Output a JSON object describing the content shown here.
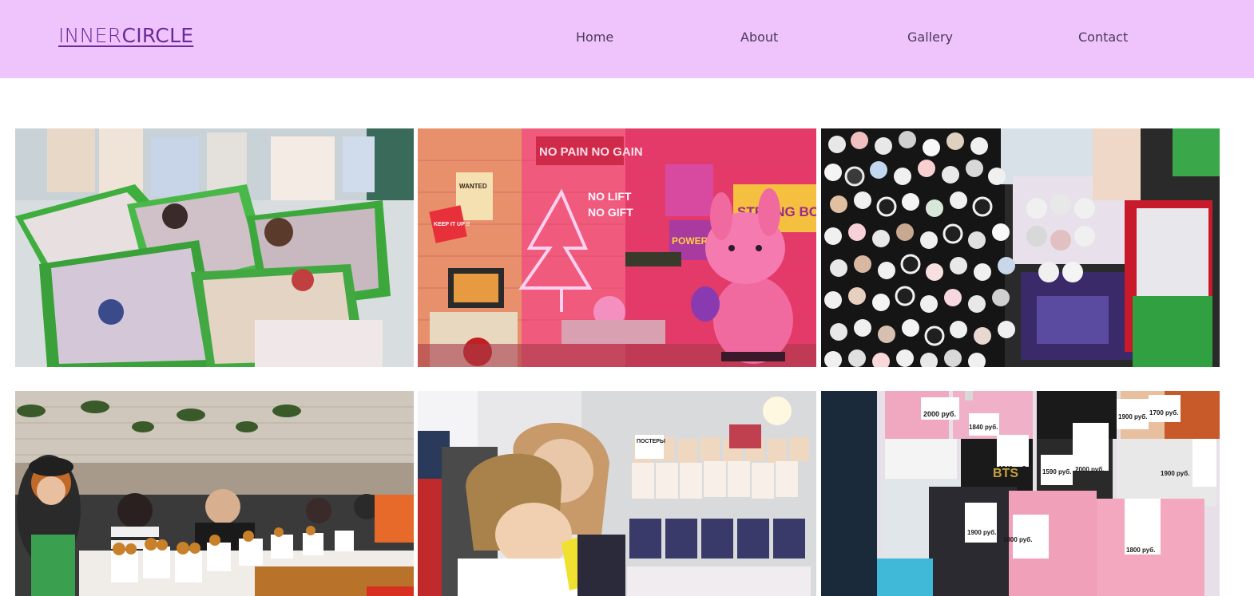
{
  "brand": {
    "part1": "INNER",
    "part2": "CIRCLE"
  },
  "nav": {
    "home": "Home",
    "about": "About",
    "gallery": "Gallery",
    "contact": "Contact"
  },
  "photos": {
    "p2": {
      "sign_top": "NO PAIN NO GAIN",
      "sign_neon1": "NO LIFT",
      "sign_neon2": "NO GIFT",
      "sign_wanted": "WANTED",
      "sign_keep": "KEEP IT UP !!",
      "sign_strong": "STRONG BODY",
      "sign_power": "POWER UP"
    },
    "p6": {
      "price1": "2000 руб.",
      "price2": "1840 руб.",
      "price3": "1900 руб.",
      "price4": "1700 руб.",
      "price5": "1840 руб.",
      "price6": "1590 руб.",
      "price7": "2000 руб.",
      "price8": "1900 руб.",
      "price9": "1900 руб.",
      "price10": "1800 руб.",
      "price11": "1800 руб.",
      "brand_label": "BTS"
    },
    "p5": {
      "sign": "ПОСТЕРЫ"
    }
  },
  "colors": {
    "nav_bg": "#efc3fc",
    "brand": "#6a2a9a",
    "page_bg": "#ffffff"
  }
}
